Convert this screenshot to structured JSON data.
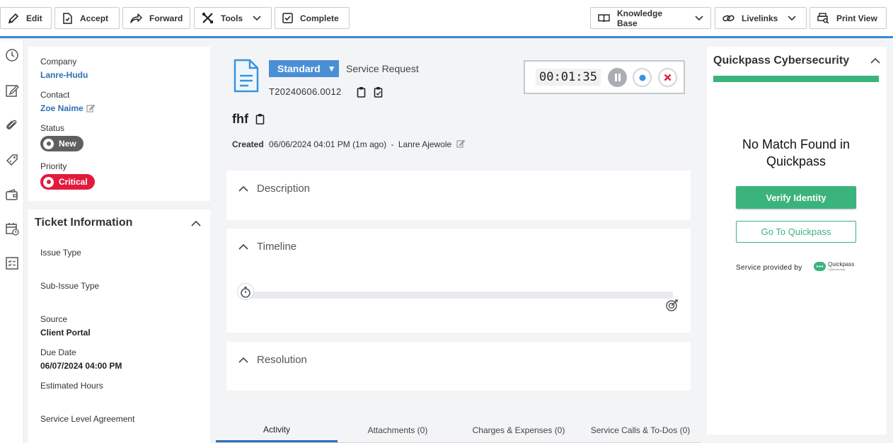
{
  "toolbar": {
    "edit": "Edit",
    "accept": "Accept",
    "forward": "Forward",
    "tools": "Tools",
    "complete": "Complete",
    "knowledge_base": "Knowledge Base",
    "livelinks": "Livelinks",
    "print_view": "Print View"
  },
  "rail": [
    "clock-icon",
    "edit-note-icon",
    "paperclip-icon",
    "tag-icon",
    "wallet-icon",
    "calendar-clock-icon",
    "checklist-icon"
  ],
  "summary": {
    "company_label": "Company",
    "company_value": "Lanre-Hudu",
    "contact_label": "Contact",
    "contact_value": "Zoe Naime",
    "status_label": "Status",
    "status_value": "New",
    "status_color": "#5f5f5f",
    "priority_label": "Priority",
    "priority_value": "Critical",
    "priority_color": "#e21b3c"
  },
  "ticket_info": {
    "title": "Ticket Information",
    "issue_type_label": "Issue Type",
    "sub_issue_type_label": "Sub-Issue Type",
    "source_label": "Source",
    "source_value": "Client Portal",
    "due_date_label": "Due Date",
    "due_date_value": "06/07/2024 04:00 PM",
    "estimated_hours_label": "Estimated Hours",
    "sla_label": "Service Level Agreement"
  },
  "header": {
    "category": "Standard",
    "request_type": "Service Request",
    "ticket_number": "T20240606.0012",
    "subject": "fhf",
    "created_label": "Created",
    "created_value": "06/06/2024 04:01 PM (1m ago)",
    "created_separator": "-",
    "created_by": "Lanre Ajewole"
  },
  "timer": {
    "elapsed": "00:01:35"
  },
  "sections": {
    "description": "Description",
    "timeline": "Timeline",
    "resolution": "Resolution"
  },
  "tabs": [
    {
      "label": "Activity",
      "active": true
    },
    {
      "label": "Attachments (0)",
      "active": false
    },
    {
      "label": "Charges & Expenses (0)",
      "active": false
    },
    {
      "label": "Service Calls & To-Dos (0)",
      "active": false
    }
  ],
  "quickpass": {
    "title": "Quickpass Cybersecurity",
    "message": "No Match Found in Quickpass",
    "verify_button": "Verify Identity",
    "goto_button": "Go To Quickpass",
    "provided_by": "Service provided by",
    "logo_name": "Quickpass",
    "logo_sub": "Cybersecurity",
    "accent_color": "#3bb37d"
  },
  "colors": {
    "accent": "#3a88d4",
    "link": "#2f6fb7"
  }
}
